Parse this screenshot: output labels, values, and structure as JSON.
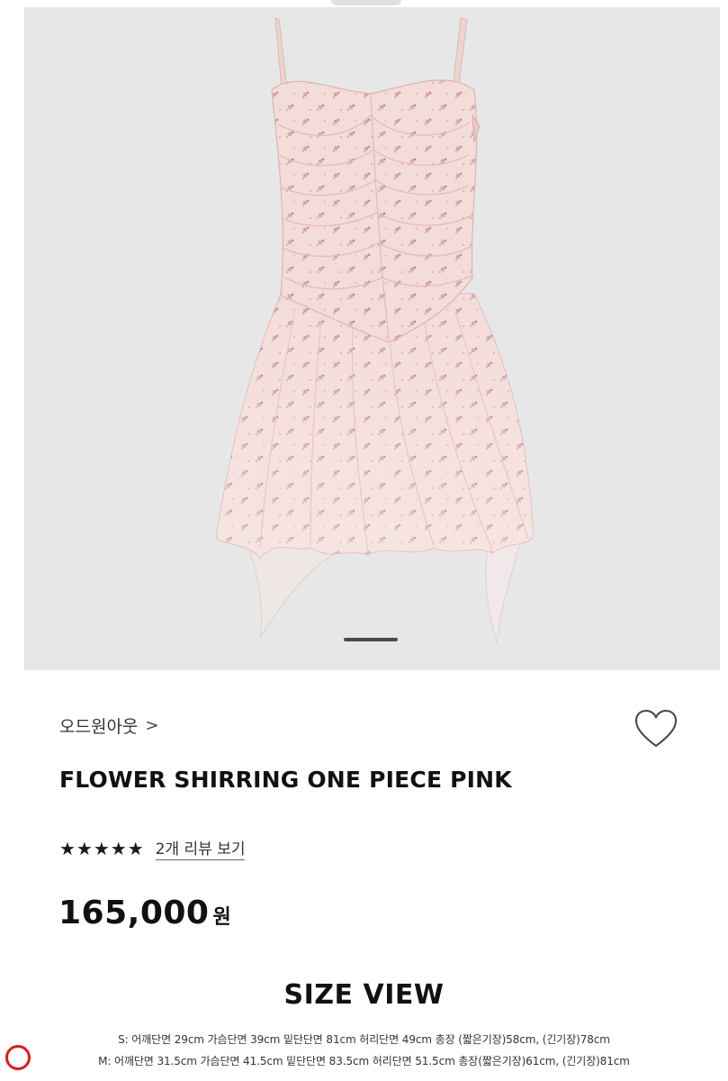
{
  "product": {
    "image_alt": "pink floral shirring mini dress",
    "brand": "오드원아웃",
    "brand_chevron": ">",
    "title": "FLOWER SHIRRING ONE PIECE PINK",
    "rating_stars": "★★★★★",
    "rating_value": 5,
    "review_link": "2개 리뷰 보기",
    "price": "165,000",
    "currency": "원"
  },
  "size_view": {
    "heading": "SIZE VIEW",
    "rows": [
      "S: 어깨단면 29cm 가슴단면 39cm 밑단단면 81cm 허리단면 49cm 총장 (짧은기장)58cm, (긴기장)78cm",
      "M: 어깨단면 31.5cm 가슴단면 41.5cm 밑단단면 83.5cm 허리단면 51.5cm 총장(짧은기장)61cm, (긴기장)81cm"
    ]
  },
  "gallery": {
    "current_slide": 1
  },
  "icons": {
    "wishlist": "heart-outline-icon",
    "brand_link": "chevron-right-icon",
    "annotation": "red-circle-mark"
  },
  "colors": {
    "image_background": "#e8e7e7",
    "dress_pink": "#f3d9d6",
    "annotation_red": "#d61f1f"
  }
}
